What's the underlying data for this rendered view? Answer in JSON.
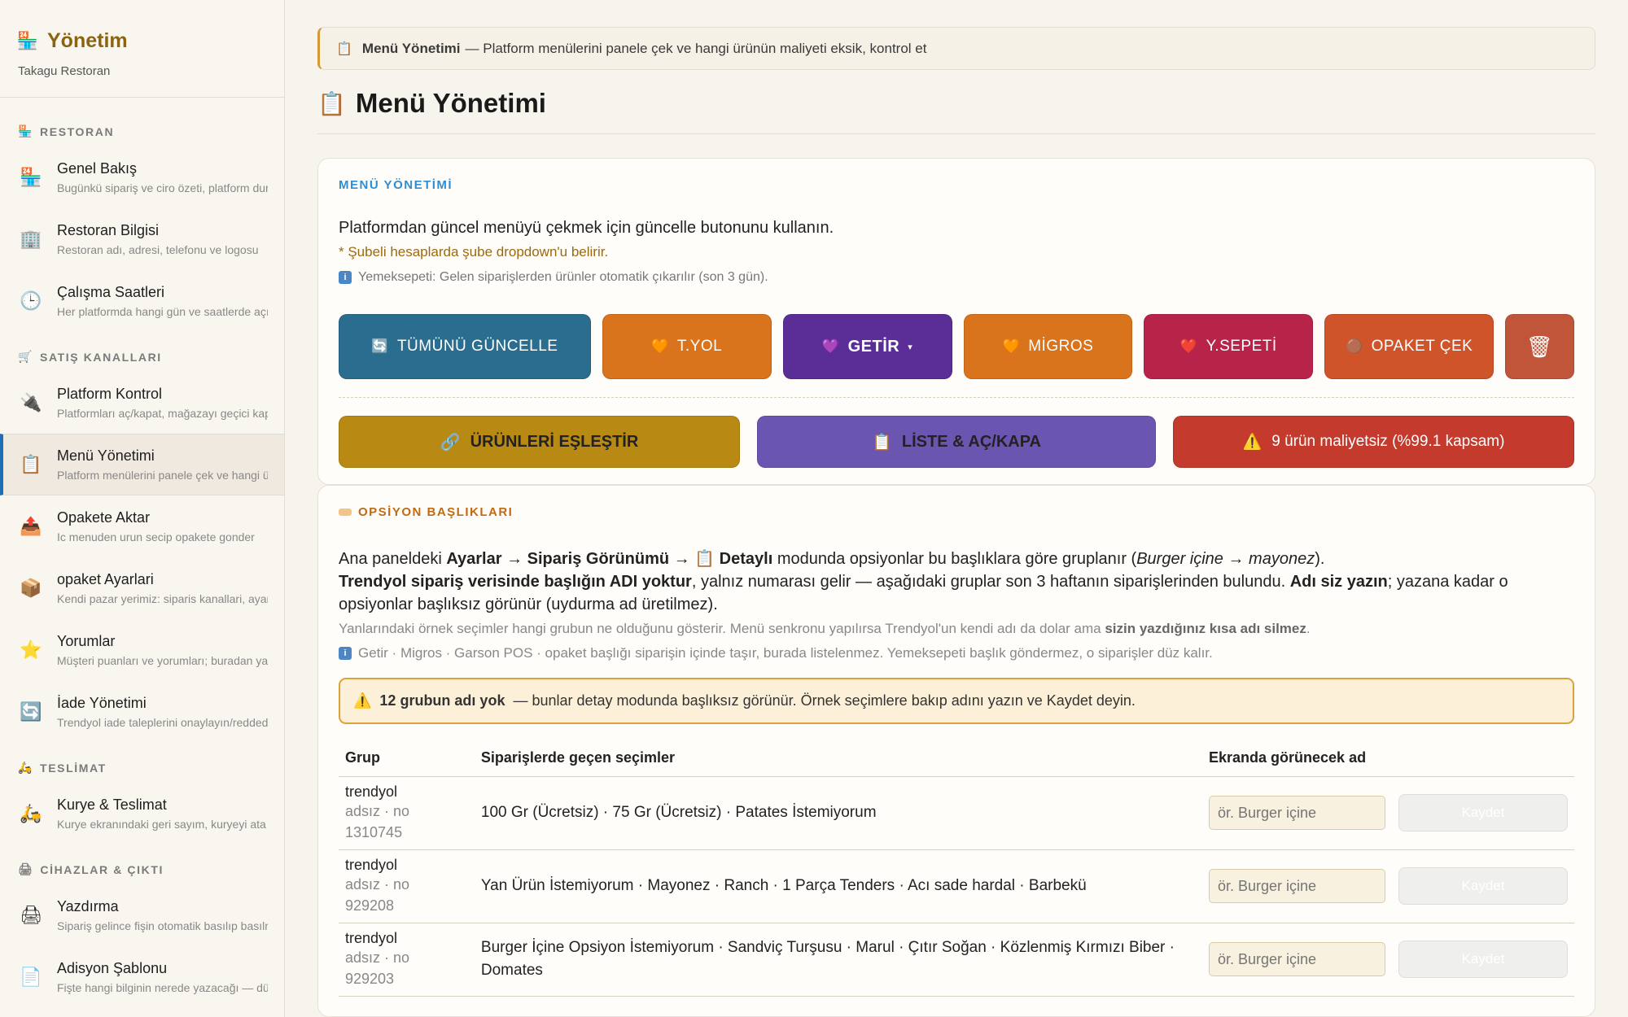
{
  "brand": {
    "title": "Yönetim",
    "subtitle": "Takagu Restoran",
    "icon": "🏪"
  },
  "sidebar": {
    "sections": [
      {
        "label": "RESTORAN",
        "icon": "🏪"
      },
      {
        "label": "SATIŞ KANALLARI",
        "icon": "🛒"
      },
      {
        "label": "TESLİMAT",
        "icon": "🛵"
      },
      {
        "label": "CİHAZLAR & ÇIKTI",
        "icon": "🖨"
      }
    ],
    "items": [
      {
        "label": "Genel Bakış",
        "desc": "Bugünkü sipariş ve ciro özeti, platform durumu",
        "icon": "🏪"
      },
      {
        "label": "Restoran Bilgisi",
        "desc": "Restoran adı, adresi, telefonu ve logosu",
        "icon": "🏢"
      },
      {
        "label": "Çalışma Saatleri",
        "desc": "Her platformda hangi gün ve saatlerde açık",
        "icon": "🕒"
      },
      {
        "label": "Platform Kontrol",
        "desc": "Platformları aç/kapat, mağazayı geçici kapat",
        "icon": "🔌"
      },
      {
        "label": "Menü Yönetimi",
        "desc": "Platform menülerini panele çek ve hangi ürünün",
        "icon": "📋"
      },
      {
        "label": "Opakete Aktar",
        "desc": "Ic menuden urun secip opakete gonder",
        "icon": "📤"
      },
      {
        "label": "opaket Ayarlari",
        "desc": "Kendi pazar yerimiz: siparis kanallari, ayarlar",
        "icon": "📦"
      },
      {
        "label": "Yorumlar",
        "desc": "Müşteri puanları ve yorumları; buradan yanıtla",
        "icon": "⭐"
      },
      {
        "label": "İade Yönetimi",
        "desc": "Trendyol iade taleplerini onaylayın/reddedin",
        "icon": "🔄"
      },
      {
        "label": "Kurye & Teslimat",
        "desc": "Kurye ekranındaki geri sayım, kuryeyi ata",
        "icon": "🛵"
      },
      {
        "label": "Yazdırma",
        "desc": "Sipariş gelince fişin otomatik basılıp basılmayacağı",
        "icon": "🖨"
      },
      {
        "label": "Adisyon Şablonu",
        "desc": "Fişte hangi bilginin nerede yazacağı — düzenle",
        "icon": "📄"
      }
    ]
  },
  "banner": {
    "icon": "📋",
    "title": "Menü Yönetimi",
    "text": "— Platform menülerini panele çek ve hangi ürünün maliyeti eksik, kontrol et"
  },
  "page": {
    "title": "Menü Yönetimi",
    "icon": "📋"
  },
  "menu_card": {
    "heading": "MENÜ YÖNETİMİ",
    "lead": "Platformdan güncel menüyü çekmek için güncelle butonunu kullanın.",
    "note": "* Şubeli hesaplarda şube dropdown'u belirir.",
    "info": "Yemeksepeti: Gelen siparişlerden ürünler otomatik çıkarılır (son 3 gün).",
    "buttons": [
      {
        "label": "TÜMÜNÜ GÜNCELLE",
        "icon": "🔄",
        "color": "#2a6d8f"
      },
      {
        "label": "T.YOL",
        "icon": "🧡",
        "color": "#d9741c"
      },
      {
        "label": "GETİR",
        "icon": "💜",
        "color": "#5b2d96",
        "caret": "▾"
      },
      {
        "label": "MİGROS",
        "icon": "🧡",
        "color": "#d9741c"
      },
      {
        "label": "Y.SEPETİ",
        "icon": "❤️",
        "color": "#b8234a"
      },
      {
        "label": "OPAKET ÇEK",
        "icon": "🟤",
        "color": "#d0542a"
      },
      {
        "label": "",
        "icon": "🗑",
        "color": "#c0553a"
      }
    ],
    "actions": [
      {
        "label": "ÜRÜNLERİ EŞLEŞTİR",
        "icon": "🔗",
        "color": "#b88a14"
      },
      {
        "label": "LİSTE & AÇ/KAPA",
        "icon": "📋",
        "color": "#6a55b0"
      },
      {
        "label": "9 ürün maliyetsiz (%99.1 kapsam)",
        "icon": "⚠️",
        "color": "#c43a2c"
      }
    ]
  },
  "options_card": {
    "heading": "OPSİYON BAŞLIKLARI",
    "p1_a": "Ana paneldeki ",
    "p1_b": "Ayarlar → Sipariş Görünümü → 📋 Detaylı",
    "p1_c": " modunda opsiyonlar bu başlıklara göre gruplanır (",
    "p1_d": "Burger içine → mayonez",
    "p1_e": ").",
    "p2_a": "Trendyol sipariş verisinde başlığın ADI yoktur",
    "p2_b": ", yalnız numarası gelir — aşağıdaki gruplar son 3 haftanın siparişlerinden bulundu. ",
    "p2_c": "Adı siz yazın",
    "p2_d": "; yazana kadar o opsiyonlar başlıksız görünür (uydurma ad üretilmez).",
    "g1_a": "Yanlarındaki örnek seçimler hangi grubun ne olduğunu gösterir. Menü senkronu yapılırsa Trendyol'un kendi adı da dolar ama ",
    "g1_b": "sizin yazdığınız kısa adı silmez",
    "g1_c": ".",
    "g2": "Getir · Migros · Garson POS · opaket başlığı siparişin içinde taşır, burada listelenmez. Yemeksepeti başlık göndermez, o siparişler düz kalır.",
    "warn_bold": "12 grubun adı yok",
    "warn_text": "— bunlar detay modunda başlıksız görünür. Örnek seçimlere bakıp adını yazın ve Kaydet deyin.",
    "table": {
      "headers": [
        "Grup",
        "Siparişlerde geçen seçimler",
        "Ekranda görünecek ad"
      ],
      "rows": [
        {
          "platform": "trendyol",
          "sub1": "adsız · no",
          "sub2": "1310745",
          "choices": "100 Gr (Ücretsiz) · 75 Gr (Ücretsiz) · Patates İstemiyorum",
          "placeholder": "ör. Burger içine",
          "save": "Kaydet"
        },
        {
          "platform": "trendyol",
          "sub1": "adsız · no",
          "sub2": "929208",
          "choices": "Yan Ürün İstemiyorum · Mayonez · Ranch · 1 Parça Tenders · Acı sade hardal · Barbekü",
          "placeholder": "ör. Burger içine",
          "save": "Kaydet"
        },
        {
          "platform": "trendyol",
          "sub1": "adsız · no",
          "sub2": "929203",
          "choices": "Burger İçine Opsiyon İstemiyorum · Sandviç Turşusu · Marul · Çıtır Soğan · Közlenmiş Kırmızı Biber · Domates",
          "placeholder": "ör. Burger içine",
          "save": "Kaydet"
        }
      ]
    }
  }
}
